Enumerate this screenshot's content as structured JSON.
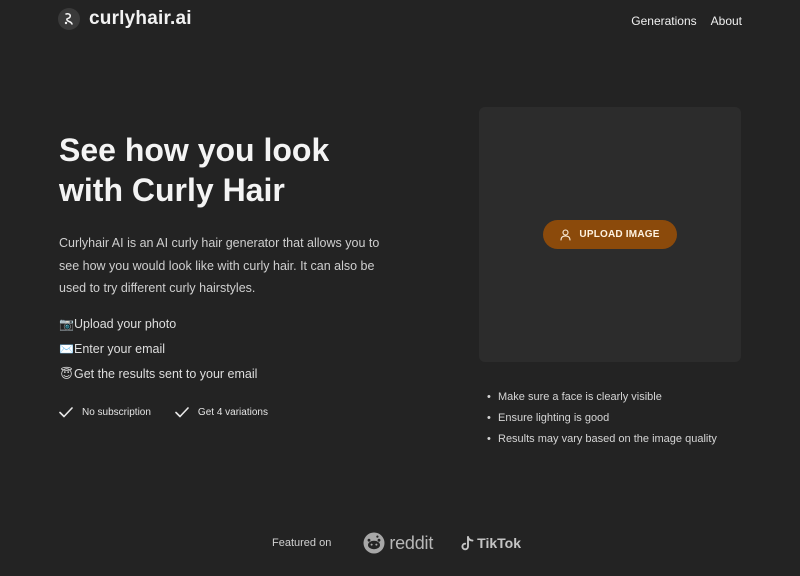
{
  "brand": {
    "name": "curlyhair.ai"
  },
  "nav": {
    "generations": "Generations",
    "about": "About"
  },
  "hero": {
    "title_line1": "See how you look",
    "title_line2": "with Curly Hair",
    "description": "Curlyhair AI is an AI curly hair generator that allows you to see how you would look like with curly hair. It can also be used to try different curly hairstyles."
  },
  "steps": [
    {
      "icon": "📷",
      "text": "Upload your photo"
    },
    {
      "icon": "✉️",
      "text": "Enter your email"
    },
    {
      "icon": "😇",
      "text": "Get the results sent to your email"
    }
  ],
  "checks": {
    "first": "No subscription",
    "second": "Get 4 variations"
  },
  "upload": {
    "button_label": "UPLOAD IMAGE",
    "accent_color": "#8b4a0b"
  },
  "tips": [
    "Make sure a face is clearly visible",
    "Ensure lighting is good",
    "Results may vary based on the image quality"
  ],
  "featured": {
    "label": "Featured on",
    "reddit": "reddit",
    "tiktok": "TikTok"
  }
}
